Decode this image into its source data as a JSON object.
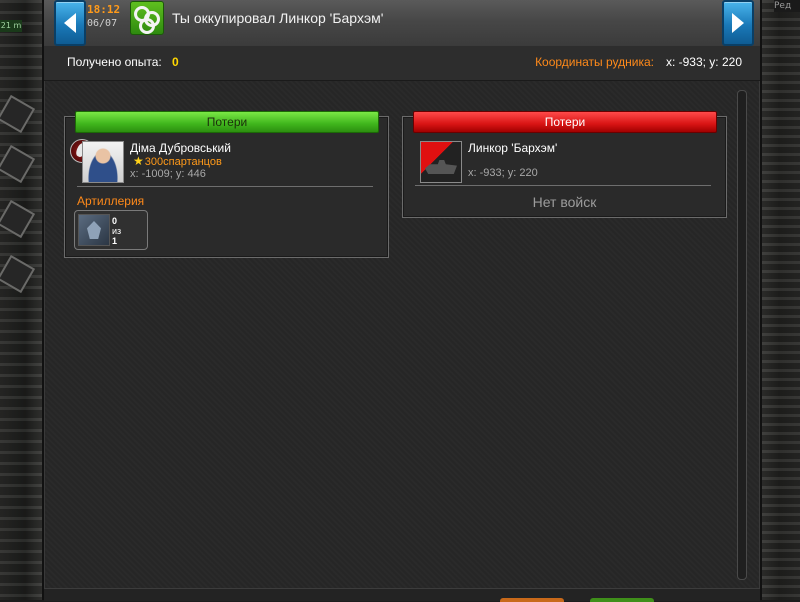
{
  "side": {
    "left_time": "21 m",
    "right_edit": "Ред"
  },
  "header": {
    "time": "18:12",
    "date": "06/07",
    "title": "Ты оккупировал Линкор 'Бархэм'",
    "event_icon": "occupy-rings-icon",
    "prev_icon": "arrow-left-icon",
    "next_icon": "arrow-right-icon"
  },
  "info": {
    "xp_label": "Получено опыта:",
    "xp_value": "0",
    "coords_label": "Координаты рудника:",
    "coords_value": "x: -933; y: 220"
  },
  "attacker": {
    "tab_label": "Потери",
    "name": "Діма Дубровський",
    "alliance": "300спартанцов",
    "coords": "x: -1009; y: 446",
    "unit_category": "Артиллерия",
    "unit_value": "0",
    "unit_of": "из",
    "unit_total": "1"
  },
  "defender": {
    "tab_label": "Потери",
    "name": "Линкор 'Бархэм'",
    "coords": "x: -933; y: 220",
    "no_troops": "Нет войск"
  },
  "colors": {
    "accent_orange": "#ff8a1a",
    "xp_yellow": "#ffd700",
    "tab_green": "#3fb51c",
    "tab_red": "#d81414",
    "nav_blue": "#1a79b8"
  }
}
